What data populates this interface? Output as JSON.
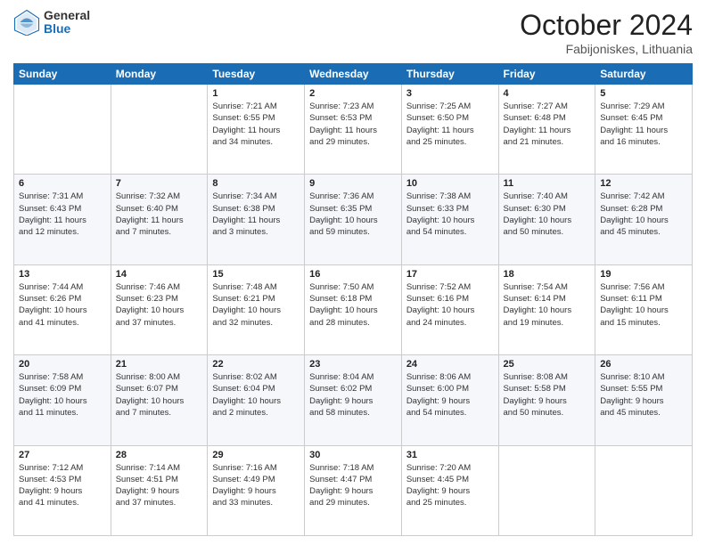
{
  "logo": {
    "general": "General",
    "blue": "Blue"
  },
  "title": "October 2024",
  "location": "Fabijoniskes, Lithuania",
  "days_header": [
    "Sunday",
    "Monday",
    "Tuesday",
    "Wednesday",
    "Thursday",
    "Friday",
    "Saturday"
  ],
  "weeks": [
    [
      {
        "day": "",
        "info": ""
      },
      {
        "day": "",
        "info": ""
      },
      {
        "day": "1",
        "info": "Sunrise: 7:21 AM\nSunset: 6:55 PM\nDaylight: 11 hours\nand 34 minutes."
      },
      {
        "day": "2",
        "info": "Sunrise: 7:23 AM\nSunset: 6:53 PM\nDaylight: 11 hours\nand 29 minutes."
      },
      {
        "day": "3",
        "info": "Sunrise: 7:25 AM\nSunset: 6:50 PM\nDaylight: 11 hours\nand 25 minutes."
      },
      {
        "day": "4",
        "info": "Sunrise: 7:27 AM\nSunset: 6:48 PM\nDaylight: 11 hours\nand 21 minutes."
      },
      {
        "day": "5",
        "info": "Sunrise: 7:29 AM\nSunset: 6:45 PM\nDaylight: 11 hours\nand 16 minutes."
      }
    ],
    [
      {
        "day": "6",
        "info": "Sunrise: 7:31 AM\nSunset: 6:43 PM\nDaylight: 11 hours\nand 12 minutes."
      },
      {
        "day": "7",
        "info": "Sunrise: 7:32 AM\nSunset: 6:40 PM\nDaylight: 11 hours\nand 7 minutes."
      },
      {
        "day": "8",
        "info": "Sunrise: 7:34 AM\nSunset: 6:38 PM\nDaylight: 11 hours\nand 3 minutes."
      },
      {
        "day": "9",
        "info": "Sunrise: 7:36 AM\nSunset: 6:35 PM\nDaylight: 10 hours\nand 59 minutes."
      },
      {
        "day": "10",
        "info": "Sunrise: 7:38 AM\nSunset: 6:33 PM\nDaylight: 10 hours\nand 54 minutes."
      },
      {
        "day": "11",
        "info": "Sunrise: 7:40 AM\nSunset: 6:30 PM\nDaylight: 10 hours\nand 50 minutes."
      },
      {
        "day": "12",
        "info": "Sunrise: 7:42 AM\nSunset: 6:28 PM\nDaylight: 10 hours\nand 45 minutes."
      }
    ],
    [
      {
        "day": "13",
        "info": "Sunrise: 7:44 AM\nSunset: 6:26 PM\nDaylight: 10 hours\nand 41 minutes."
      },
      {
        "day": "14",
        "info": "Sunrise: 7:46 AM\nSunset: 6:23 PM\nDaylight: 10 hours\nand 37 minutes."
      },
      {
        "day": "15",
        "info": "Sunrise: 7:48 AM\nSunset: 6:21 PM\nDaylight: 10 hours\nand 32 minutes."
      },
      {
        "day": "16",
        "info": "Sunrise: 7:50 AM\nSunset: 6:18 PM\nDaylight: 10 hours\nand 28 minutes."
      },
      {
        "day": "17",
        "info": "Sunrise: 7:52 AM\nSunset: 6:16 PM\nDaylight: 10 hours\nand 24 minutes."
      },
      {
        "day": "18",
        "info": "Sunrise: 7:54 AM\nSunset: 6:14 PM\nDaylight: 10 hours\nand 19 minutes."
      },
      {
        "day": "19",
        "info": "Sunrise: 7:56 AM\nSunset: 6:11 PM\nDaylight: 10 hours\nand 15 minutes."
      }
    ],
    [
      {
        "day": "20",
        "info": "Sunrise: 7:58 AM\nSunset: 6:09 PM\nDaylight: 10 hours\nand 11 minutes."
      },
      {
        "day": "21",
        "info": "Sunrise: 8:00 AM\nSunset: 6:07 PM\nDaylight: 10 hours\nand 7 minutes."
      },
      {
        "day": "22",
        "info": "Sunrise: 8:02 AM\nSunset: 6:04 PM\nDaylight: 10 hours\nand 2 minutes."
      },
      {
        "day": "23",
        "info": "Sunrise: 8:04 AM\nSunset: 6:02 PM\nDaylight: 9 hours\nand 58 minutes."
      },
      {
        "day": "24",
        "info": "Sunrise: 8:06 AM\nSunset: 6:00 PM\nDaylight: 9 hours\nand 54 minutes."
      },
      {
        "day": "25",
        "info": "Sunrise: 8:08 AM\nSunset: 5:58 PM\nDaylight: 9 hours\nand 50 minutes."
      },
      {
        "day": "26",
        "info": "Sunrise: 8:10 AM\nSunset: 5:55 PM\nDaylight: 9 hours\nand 45 minutes."
      }
    ],
    [
      {
        "day": "27",
        "info": "Sunrise: 7:12 AM\nSunset: 4:53 PM\nDaylight: 9 hours\nand 41 minutes."
      },
      {
        "day": "28",
        "info": "Sunrise: 7:14 AM\nSunset: 4:51 PM\nDaylight: 9 hours\nand 37 minutes."
      },
      {
        "day": "29",
        "info": "Sunrise: 7:16 AM\nSunset: 4:49 PM\nDaylight: 9 hours\nand 33 minutes."
      },
      {
        "day": "30",
        "info": "Sunrise: 7:18 AM\nSunset: 4:47 PM\nDaylight: 9 hours\nand 29 minutes."
      },
      {
        "day": "31",
        "info": "Sunrise: 7:20 AM\nSunset: 4:45 PM\nDaylight: 9 hours\nand 25 minutes."
      },
      {
        "day": "",
        "info": ""
      },
      {
        "day": "",
        "info": ""
      }
    ]
  ]
}
